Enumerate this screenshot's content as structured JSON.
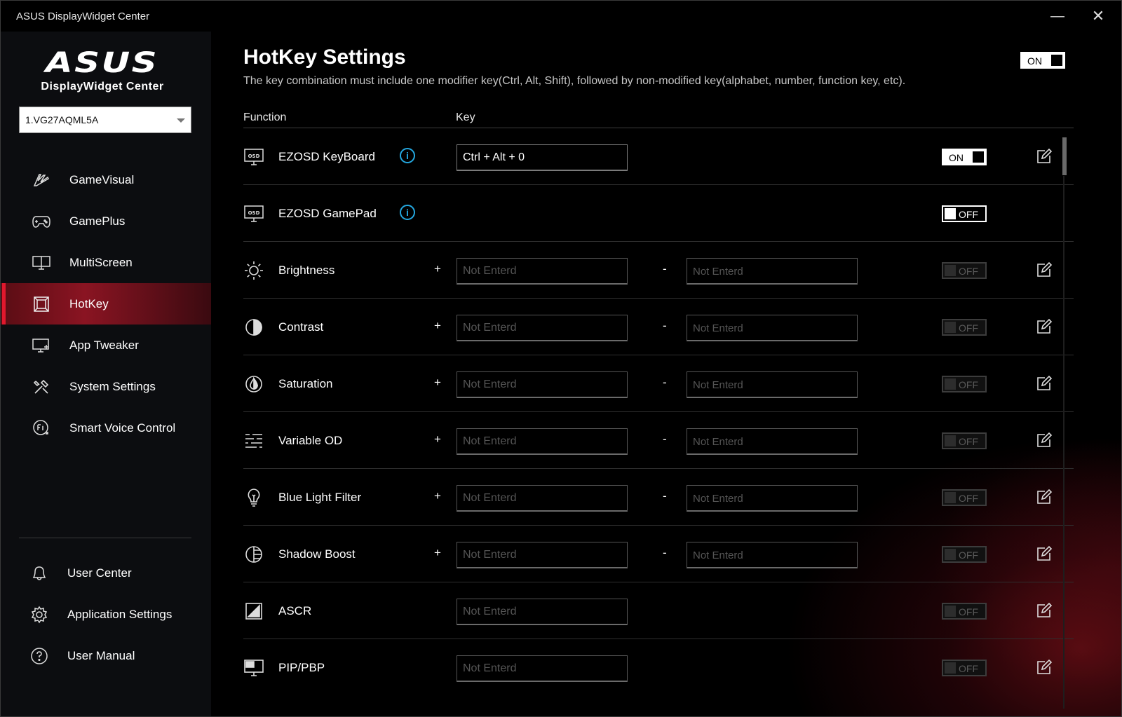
{
  "window": {
    "title": "ASUS DisplayWidget Center",
    "minimize_label": "—",
    "close_label": "✕"
  },
  "sidebar": {
    "brand": "ASUS",
    "product": "DisplayWidget Center",
    "device": "1.VG27AQML5A",
    "items": [
      {
        "label": "GameVisual",
        "icon": "gamevisual-icon"
      },
      {
        "label": "GamePlus",
        "icon": "gamepad-icon"
      },
      {
        "label": "MultiScreen",
        "icon": "multiscreen-icon"
      },
      {
        "label": "HotKey",
        "icon": "hotkey-icon",
        "active": true
      },
      {
        "label": "App Tweaker",
        "icon": "app-tweaker-icon"
      },
      {
        "label": "System Settings",
        "icon": "tools-icon"
      },
      {
        "label": "Smart Voice Control",
        "icon": "voice-icon"
      }
    ],
    "bottom_items": [
      {
        "label": "User Center",
        "icon": "user-icon"
      },
      {
        "label": "Application Settings",
        "icon": "gear-icon"
      },
      {
        "label": "User Manual",
        "icon": "help-icon"
      }
    ]
  },
  "main": {
    "title": "HotKey Settings",
    "description": "The key combination must include one modifier key(Ctrl, Alt, Shift), followed by non-modified key(alphabet, number, function key, etc).",
    "global_toggle": "ON",
    "columns": {
      "function": "Function",
      "key": "Key"
    },
    "plus": "+",
    "minus": "-",
    "rows": [
      {
        "name": "EZOSD KeyBoard",
        "info": "i",
        "key1": "Ctrl + Alt + 0",
        "toggle": "ON"
      },
      {
        "name": "EZOSD GamePad",
        "info": "i",
        "toggle": "OFF"
      },
      {
        "name": "Brightness",
        "key1": "Not Enterd",
        "key2": "Not Enterd",
        "toggle": "OFF"
      },
      {
        "name": "Contrast",
        "key1": "Not Enterd",
        "key2": "Not Enterd",
        "toggle": "OFF"
      },
      {
        "name": "Saturation",
        "key1": "Not Enterd",
        "key2": "Not Enterd",
        "toggle": "OFF"
      },
      {
        "name": "Variable OD",
        "key1": "Not Enterd",
        "key2": "Not Enterd",
        "toggle": "OFF"
      },
      {
        "name": "Blue Light Filter",
        "key1": "Not Enterd",
        "key2": "Not Enterd",
        "toggle": "OFF"
      },
      {
        "name": "Shadow Boost",
        "key1": "Not Enterd",
        "key2": "Not Enterd",
        "toggle": "OFF"
      },
      {
        "name": "ASCR",
        "key1": "Not Enterd",
        "toggle": "OFF"
      },
      {
        "name": "PIP/PBP",
        "key1": "Not Enterd",
        "toggle": "OFF"
      }
    ]
  }
}
